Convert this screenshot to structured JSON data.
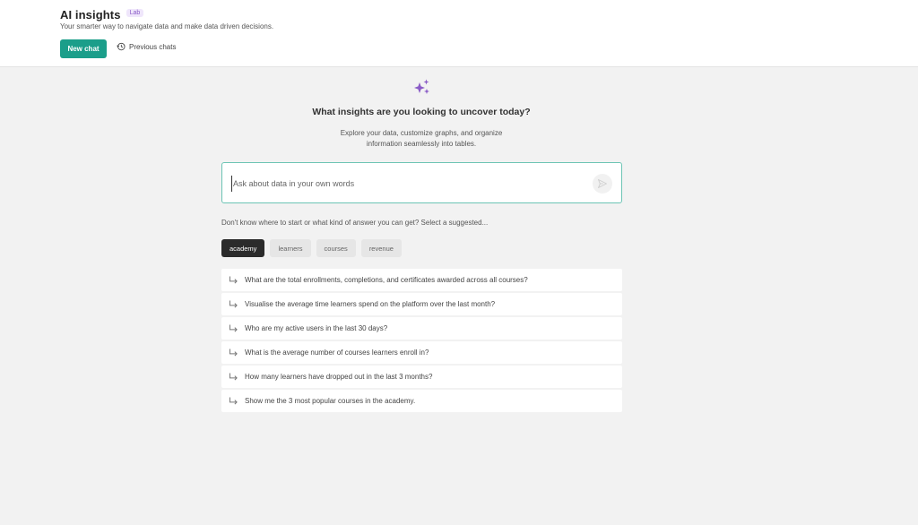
{
  "header": {
    "title": "AI insights",
    "badge": "Lab",
    "subtitle": "Your smarter way to navigate data and make data driven decisions.",
    "new_chat_label": "New chat",
    "previous_chats_label": "Previous chats"
  },
  "hero": {
    "icon": "sparkles-icon",
    "title": "What insights are you looking to uncover today?",
    "description_line1": "Explore your data, customize graphs, and organize",
    "description_line2": "information seamlessly into tables."
  },
  "ask": {
    "placeholder": "Ask about data in your own words",
    "value": "",
    "send_icon": "send-icon"
  },
  "hint": "Don't know where to start or what kind of answer you can get? Select a suggested...",
  "chips": [
    {
      "label": "academy",
      "active": true
    },
    {
      "label": "learners",
      "active": false
    },
    {
      "label": "courses",
      "active": false
    },
    {
      "label": "revenue",
      "active": false
    }
  ],
  "suggestions": [
    "What are the total enrollments, completions, and certificates awarded across all courses?",
    "Visualise the average time learners spend on the platform over the last month?",
    "Who are my active users in the last 30 days?",
    "What is the average number of courses learners enroll in?",
    "How many learners have dropped out in the last 3 months?",
    "Show me the 3 most popular courses in the academy."
  ],
  "colors": {
    "accent": "#1b9e8a",
    "sparkle": "#8a5cc7",
    "chip_active": "#2b2b2b",
    "background": "#f2f2f2"
  }
}
